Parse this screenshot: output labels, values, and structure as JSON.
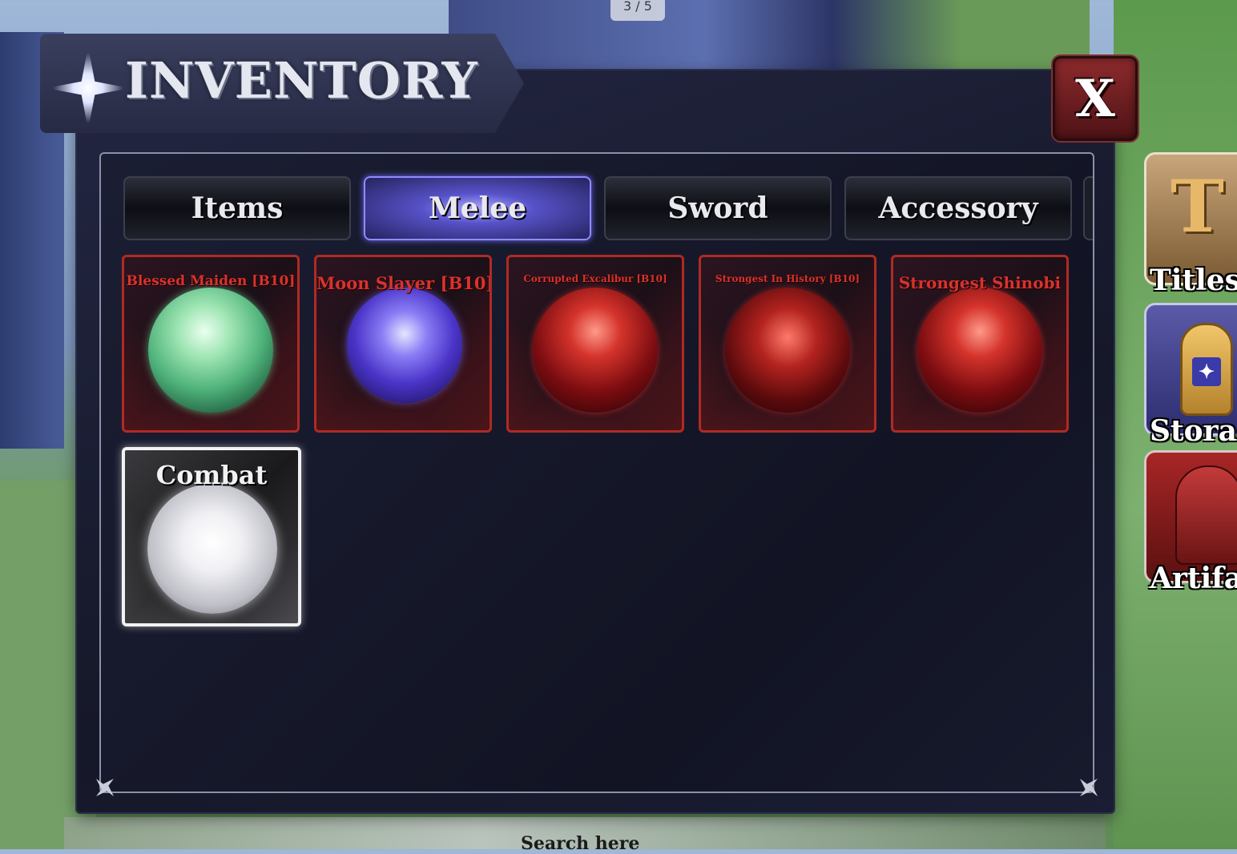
{
  "page_counter": "3 / 5",
  "header": {
    "title": "INVENTORY"
  },
  "close_label": "X",
  "tabs": [
    {
      "label": "Items",
      "active": false
    },
    {
      "label": "Melee",
      "active": true
    },
    {
      "label": "Sword",
      "active": false
    },
    {
      "label": "Accessory",
      "active": false
    }
  ],
  "items": [
    {
      "name": "Blessed Maiden [B10]",
      "orb": "green-orb-icon"
    },
    {
      "name": "Moon Slayer [B10]",
      "orb": "purple-orb-icon"
    },
    {
      "name": "Corrupted Excalibur [B10]",
      "orb": "red-orb-icon"
    },
    {
      "name": "Strongest In History [B10]",
      "orb": "red-orb-icon"
    },
    {
      "name": "Strongest Shinobi",
      "orb": "red-orb-icon"
    },
    {
      "name": "Combat",
      "orb": "white-orb-icon"
    }
  ],
  "side_menu": [
    {
      "label": "Titles",
      "icon": "letter-t-icon"
    },
    {
      "label": "Storage",
      "icon": "storage-capsule-icon"
    },
    {
      "label": "Artifacts",
      "icon": "helmet-icon"
    }
  ],
  "search": {
    "hint": "Search here"
  },
  "colors": {
    "accent_purple": "#5752c8",
    "rarity_red": "#b02a24",
    "panel_bg": "#151828"
  }
}
